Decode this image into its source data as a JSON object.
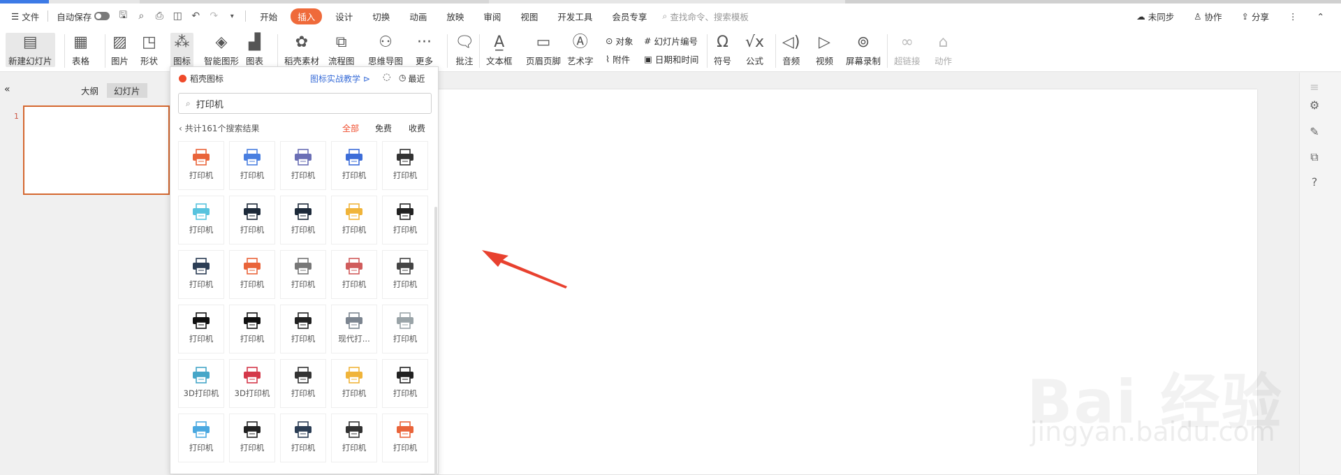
{
  "menubar": {
    "file": "文件",
    "autosave": "自动保存",
    "tabs": [
      "开始",
      "插入",
      "设计",
      "切换",
      "动画",
      "放映",
      "审阅",
      "视图",
      "开发工具",
      "会员专享"
    ],
    "search_placeholder": "查找命令、搜索模板",
    "sync": "未同步",
    "collab": "协作",
    "share": "分享"
  },
  "ribbon": {
    "new_slide": "新建幻灯片",
    "table": "表格",
    "picture": "图片",
    "shape": "形状",
    "icon": "图标",
    "smart_graphic": "智能图形",
    "chart": "图表",
    "material": "稻壳素材",
    "flowchart": "流程图",
    "mindmap": "思维导图",
    "more": "更多",
    "comment": "批注",
    "textbox": "文本框",
    "header_footer": "页眉页脚",
    "wordart": "艺术字",
    "object": "对象",
    "attachment": "附件",
    "slide_number": "幻灯片编号",
    "date_time": "日期和时间",
    "symbol": "符号",
    "formula": "公式",
    "audio": "音频",
    "video": "视频",
    "screen_record": "屏幕录制",
    "hyperlink": "超链接",
    "action": "动作"
  },
  "panel": {
    "outline": "大纲",
    "slides": "幻灯片",
    "slide_number": "1"
  },
  "popup": {
    "title": "稻壳图标",
    "tutorial": "图标实战教学",
    "recent": "最近",
    "search_value": "打印机",
    "result_count": "共计161个搜索结果",
    "filters": [
      "全部",
      "免费",
      "收费"
    ],
    "colors": {
      "active_filter": "#ef4a2a",
      "link": "#3a6ed8"
    },
    "items": [
      {
        "label": "打印机",
        "color": "#e9643a"
      },
      {
        "label": "打印机",
        "color": "#4a7fe0"
      },
      {
        "label": "打印机",
        "color": "#6b6fb5"
      },
      {
        "label": "打印机",
        "color": "#3d6dd8"
      },
      {
        "label": "打印机",
        "color": "#333333"
      },
      {
        "label": "打印机",
        "color": "#58c3de"
      },
      {
        "label": "打印机",
        "color": "#1d2a3a"
      },
      {
        "label": "打印机",
        "color": "#1d2a3a"
      },
      {
        "label": "打印机",
        "color": "#f0b43a"
      },
      {
        "label": "打印机",
        "color": "#222222"
      },
      {
        "label": "打印机",
        "color": "#2c3e55"
      },
      {
        "label": "打印机",
        "color": "#e9643a"
      },
      {
        "label": "打印机",
        "color": "#777777"
      },
      {
        "label": "打印机",
        "color": "#d05c5c"
      },
      {
        "label": "打印机",
        "color": "#444444"
      },
      {
        "label": "打印机",
        "color": "#111111"
      },
      {
        "label": "打印机",
        "color": "#111111"
      },
      {
        "label": "打印机",
        "color": "#222222"
      },
      {
        "label": "现代打...",
        "color": "#7c8590"
      },
      {
        "label": "打印机",
        "color": "#9aa4a8"
      },
      {
        "label": "3D打印机",
        "color": "#45a6c8"
      },
      {
        "label": "3D打印机",
        "color": "#d4384a"
      },
      {
        "label": "打印机",
        "color": "#333333"
      },
      {
        "label": "打印机",
        "color": "#f0b43a"
      },
      {
        "label": "打印机",
        "color": "#222222"
      },
      {
        "label": "打印机",
        "color": "#4aa8e0"
      },
      {
        "label": "打印机",
        "color": "#222222"
      },
      {
        "label": "打印机",
        "color": "#2c3e55"
      },
      {
        "label": "打印机",
        "color": "#333333"
      },
      {
        "label": "打印机",
        "color": "#e9643a"
      }
    ]
  },
  "watermark": {
    "logo": "Bai 经验",
    "url": "jingyan.baidu.com"
  }
}
